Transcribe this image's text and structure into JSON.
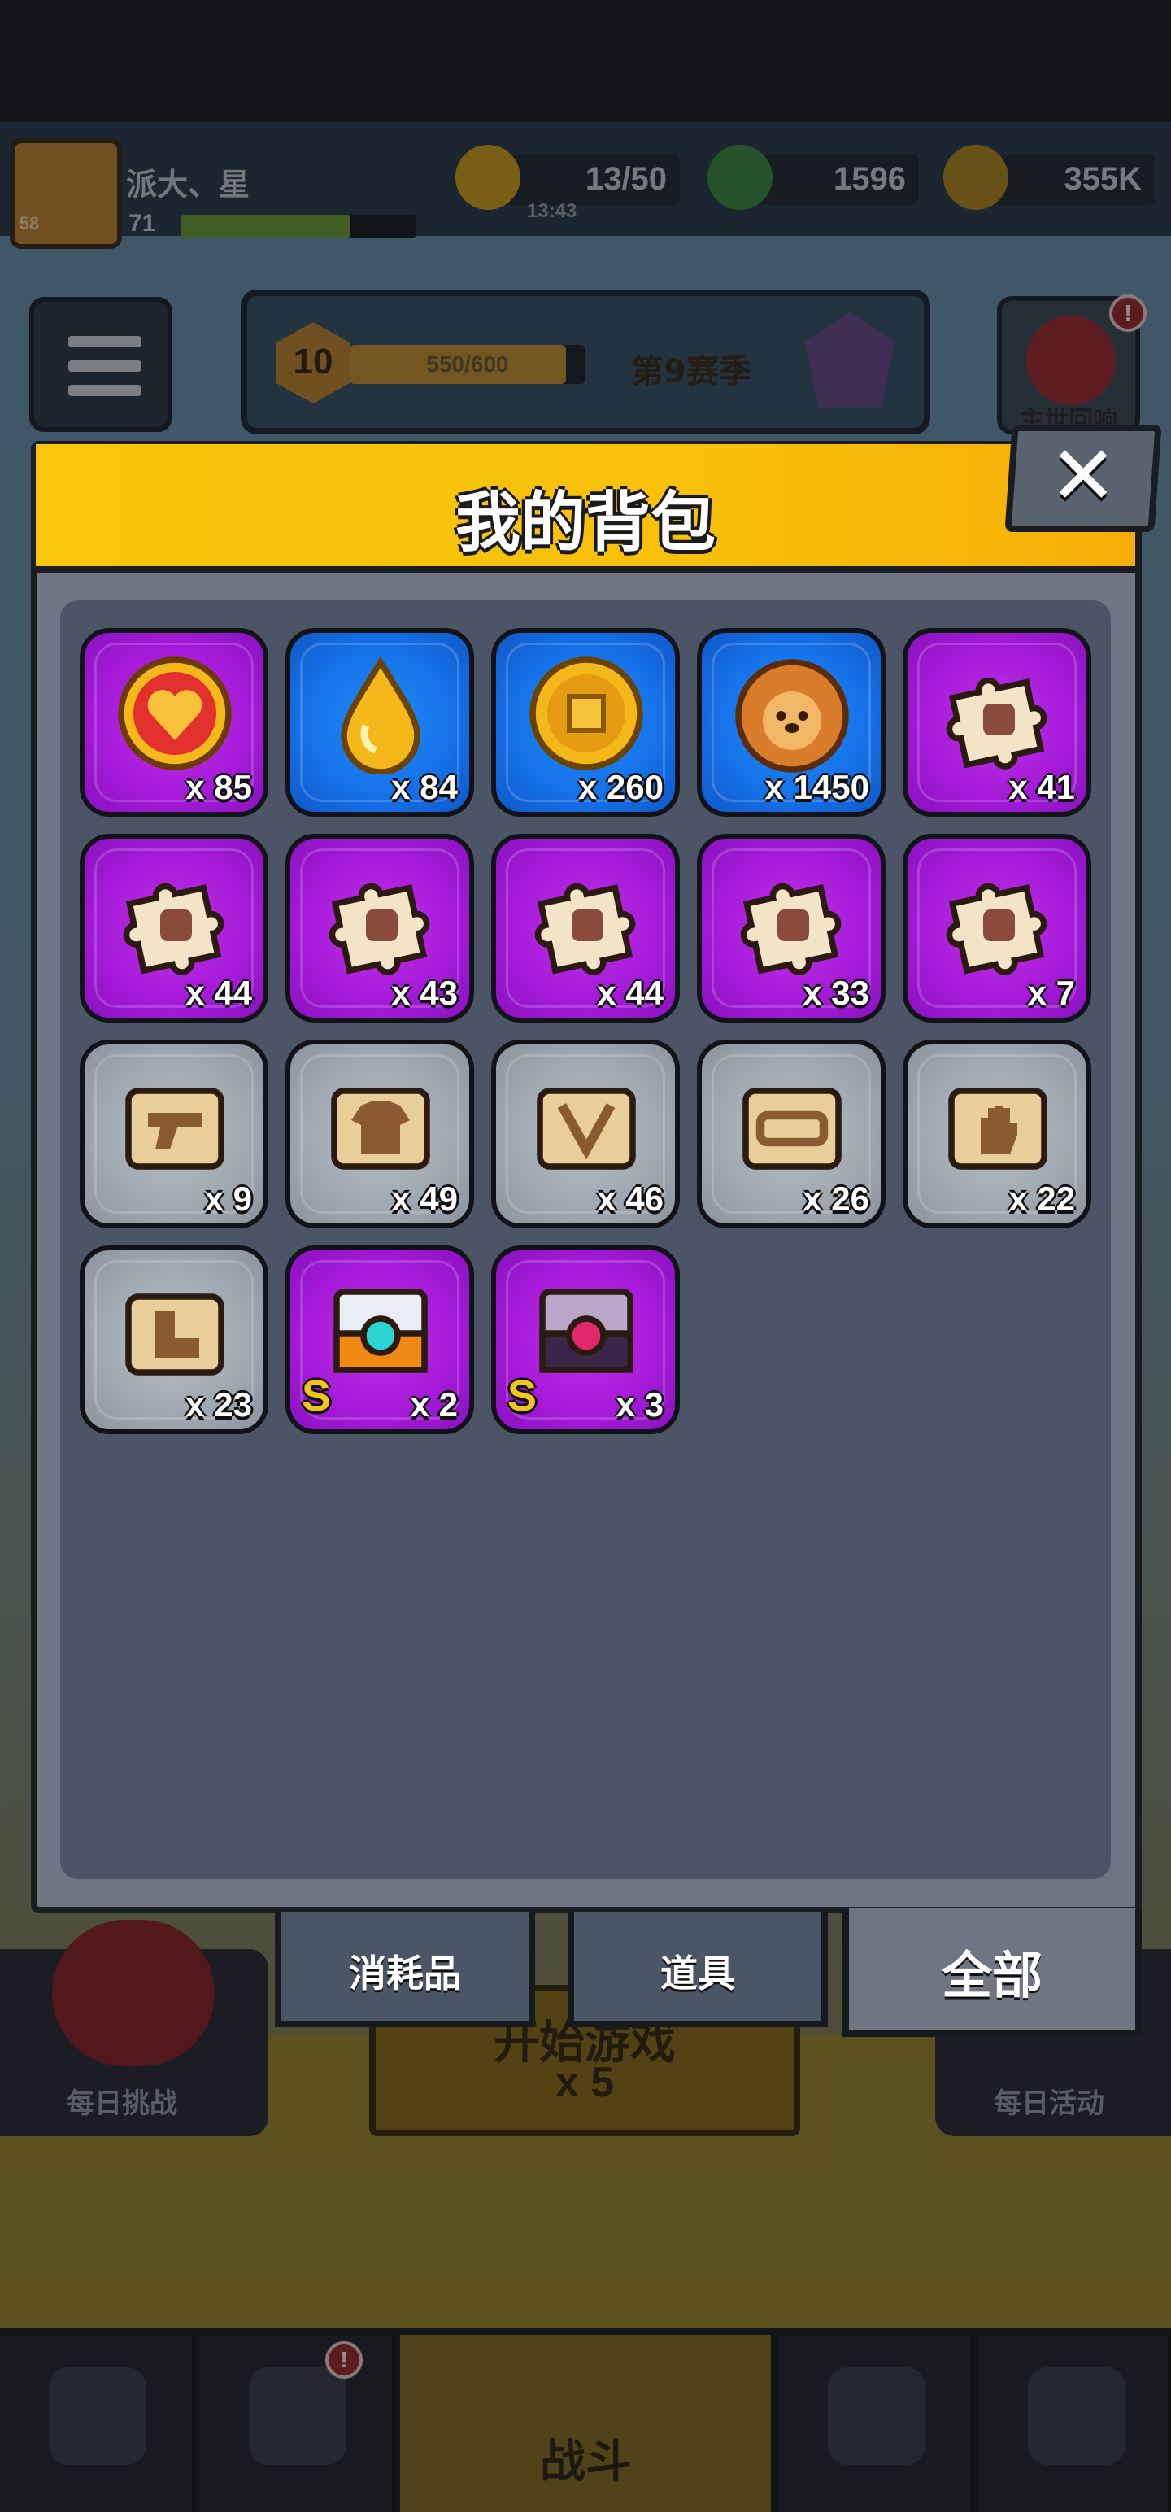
{
  "player": {
    "name": "派大、星",
    "level_badge": "58",
    "xp_level": "71",
    "xp_fraction": 0.72
  },
  "resources": [
    {
      "name": "energy",
      "value": "13/50",
      "icon": "lightning-icon",
      "color": "#f2c51a"
    },
    {
      "name": "gems",
      "value": "1596",
      "icon": "green-gem-icon",
      "color": "#4bbf4b"
    },
    {
      "name": "coins",
      "value": "355K",
      "icon": "coin-icon",
      "color": "#f2c51a"
    }
  ],
  "energy_timer": "13:43",
  "season": {
    "level": "10",
    "progress": "550/600",
    "progress_fraction": 0.917,
    "name": "第9赛季"
  },
  "event_button": {
    "label": "主世回响",
    "badge": "!"
  },
  "side_left_label": "每日挑战",
  "side_right_label": "每日活动",
  "play_button": {
    "label": "开始游戏",
    "cost": "x 5"
  },
  "bottom_nav": {
    "battle_label": "战斗",
    "badge": "!"
  },
  "modal": {
    "title": "我的背包",
    "close_label": "✕"
  },
  "items": [
    {
      "name": "heart",
      "rarity": "purple",
      "count": "x 85",
      "icon": "heart-icon"
    },
    {
      "name": "oil-drop",
      "rarity": "blue",
      "count": "x 84",
      "icon": "drop-icon"
    },
    {
      "name": "gold-coin",
      "rarity": "blue",
      "count": "x 260",
      "icon": "gold-coin-icon"
    },
    {
      "name": "dog-cookie",
      "rarity": "blue",
      "count": "x 1450",
      "icon": "dog-cookie-icon"
    },
    {
      "name": "puzzle-1",
      "rarity": "purple",
      "count": "x 41",
      "icon": "puzzle-icon"
    },
    {
      "name": "puzzle-2",
      "rarity": "purple",
      "count": "x 44",
      "icon": "puzzle-icon"
    },
    {
      "name": "puzzle-3",
      "rarity": "purple",
      "count": "x 43",
      "icon": "puzzle-icon"
    },
    {
      "name": "puzzle-4",
      "rarity": "purple",
      "count": "x 44",
      "icon": "puzzle-icon"
    },
    {
      "name": "puzzle-5",
      "rarity": "purple",
      "count": "x 33",
      "icon": "puzzle-icon"
    },
    {
      "name": "puzzle-6",
      "rarity": "purple",
      "count": "x 7",
      "icon": "puzzle-icon"
    },
    {
      "name": "scroll-gun",
      "rarity": "gray",
      "count": "x 9",
      "icon": "scroll-gun-icon"
    },
    {
      "name": "scroll-shirt",
      "rarity": "gray",
      "count": "x 49",
      "icon": "scroll-shirt-icon"
    },
    {
      "name": "scroll-necklace",
      "rarity": "gray",
      "count": "x 46",
      "icon": "scroll-necklace-icon"
    },
    {
      "name": "scroll-belt",
      "rarity": "gray",
      "count": "x 26",
      "icon": "scroll-belt-icon"
    },
    {
      "name": "scroll-glove",
      "rarity": "gray",
      "count": "x 22",
      "icon": "scroll-glove-icon"
    },
    {
      "name": "scroll-boots",
      "rarity": "gray",
      "count": "x 23",
      "icon": "scroll-boots-icon"
    },
    {
      "name": "chest-orange",
      "rarity": "purple",
      "count": "x 2",
      "grade": "S",
      "icon": "chest-icon"
    },
    {
      "name": "chest-dark",
      "rarity": "purple",
      "count": "x 3",
      "grade": "S",
      "icon": "chest-icon"
    }
  ],
  "tabs": [
    {
      "label": "消耗品",
      "active": false
    },
    {
      "label": "道具",
      "active": false
    },
    {
      "label": "全部",
      "active": true
    }
  ]
}
